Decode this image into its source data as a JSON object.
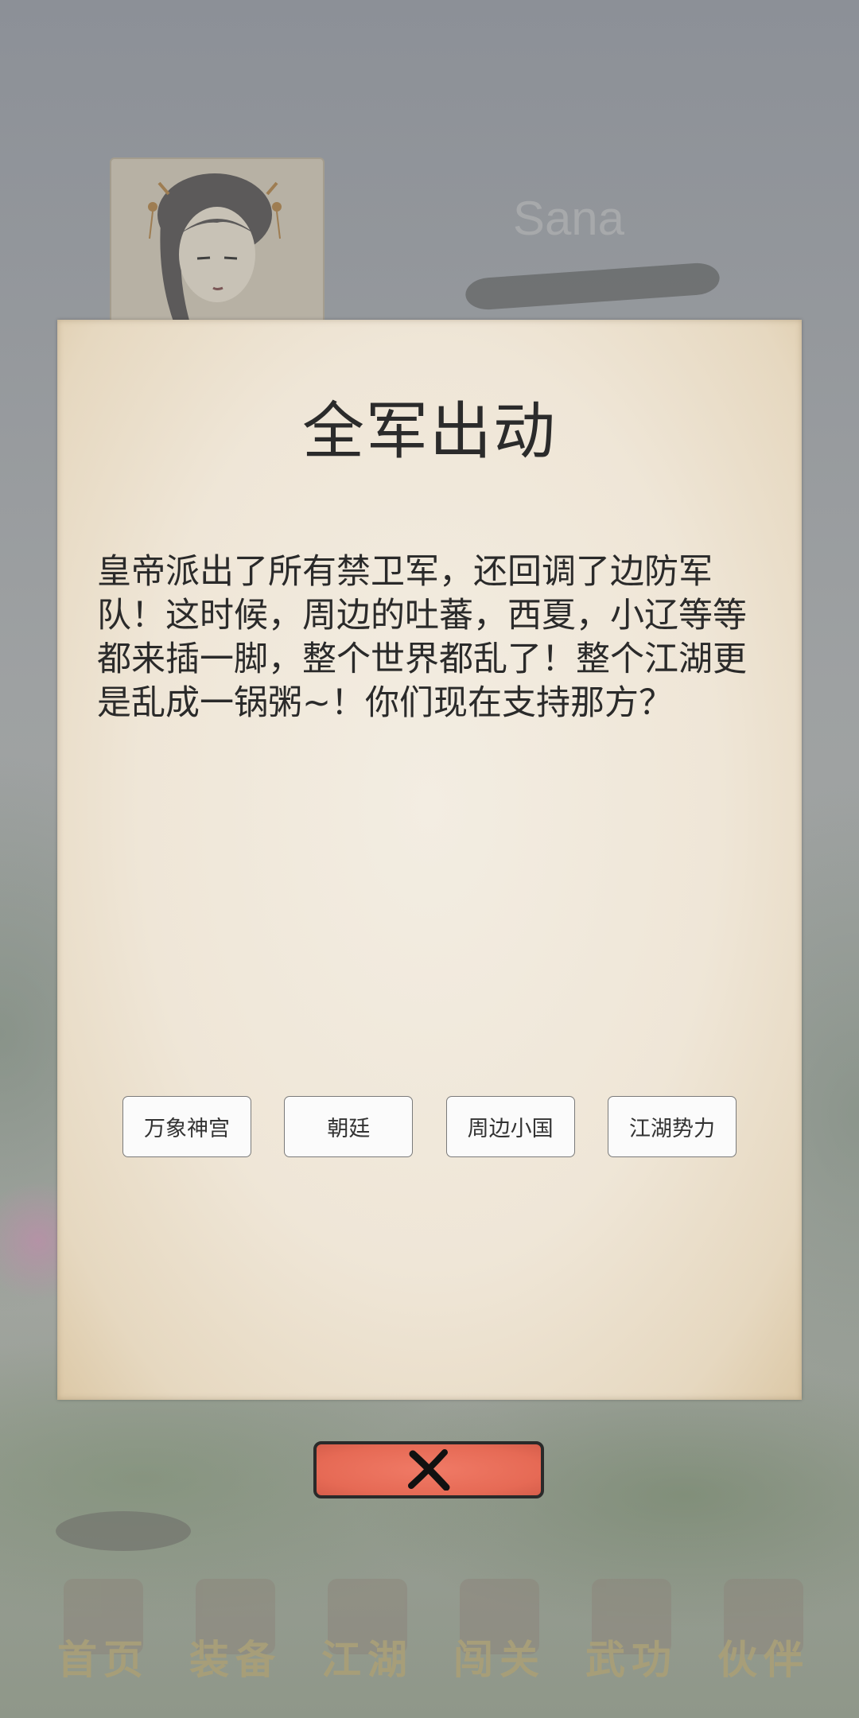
{
  "background": {
    "player_name": "Sana",
    "nav": [
      {
        "label": "首页",
        "icon": "gate-icon"
      },
      {
        "label": "装备",
        "icon": "armor-icon"
      },
      {
        "label": "江湖",
        "icon": "house-icon"
      },
      {
        "label": "闯关",
        "icon": "scroll-icon"
      },
      {
        "label": "武功",
        "icon": "book-icon"
      },
      {
        "label": "伙伴",
        "icon": "partners-icon"
      }
    ]
  },
  "dialog": {
    "title": "全军出动",
    "body": "皇帝派出了所有禁卫军，还回调了边防军队！这时候，周边的吐蕃，西夏，小辽等等都来插一脚，整个世界都乱了！整个江湖更是乱成一锅粥~！你们现在支持那方？",
    "choices": [
      "万象神宫",
      "朝廷",
      "周边小国",
      "江湖势力"
    ],
    "close_icon": "close-x-icon"
  },
  "colors": {
    "close_button": "#e66a55",
    "paper": "#efe6d7",
    "nav_text": "#b9a36a"
  }
}
